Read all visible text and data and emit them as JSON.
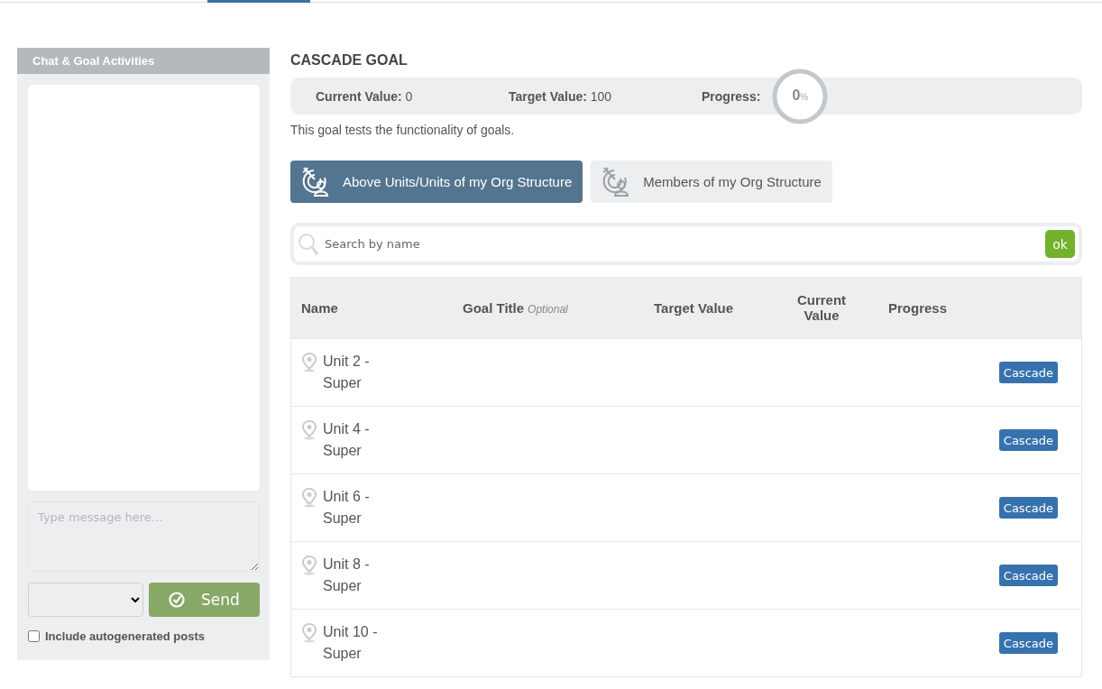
{
  "chat": {
    "title": "Chat & Goal Activities",
    "message": {
      "placeholder": "Type message here..."
    },
    "send_label": "Send",
    "include_autogenerated": {
      "label": "Include autogenerated posts",
      "checked": false
    }
  },
  "goal": {
    "title": "CASCADE GOAL",
    "stats": [
      {
        "label": "Current Value:",
        "value": "0"
      },
      {
        "label": "Target Value:",
        "value": "100"
      }
    ],
    "progress": {
      "label": "Progress:",
      "value": "0",
      "unit": "%"
    },
    "description": "This goal tests the functionality of goals."
  },
  "tabs": [
    {
      "label": "Above Units/Units of my Org Structure",
      "selected": true
    },
    {
      "label": "Members of my Org Structure",
      "selected": false
    }
  ],
  "search": {
    "placeholder": "Search by name",
    "button": "ok"
  },
  "table": {
    "columns": [
      {
        "label": "Name"
      },
      {
        "label": "Goal Title",
        "hint": "Optional"
      },
      {
        "label": "Target Value"
      },
      {
        "label": "Current Value"
      },
      {
        "label": "Progress"
      }
    ],
    "rows": [
      {
        "name": "Unit 2 - Super",
        "action": "Cascade"
      },
      {
        "name": "Unit 4 - Super",
        "action": "Cascade"
      },
      {
        "name": "Unit 6 - Super",
        "action": "Cascade"
      },
      {
        "name": "Unit 8 - Super",
        "action": "Cascade"
      },
      {
        "name": "Unit 10 - Super",
        "action": "Cascade"
      }
    ]
  }
}
